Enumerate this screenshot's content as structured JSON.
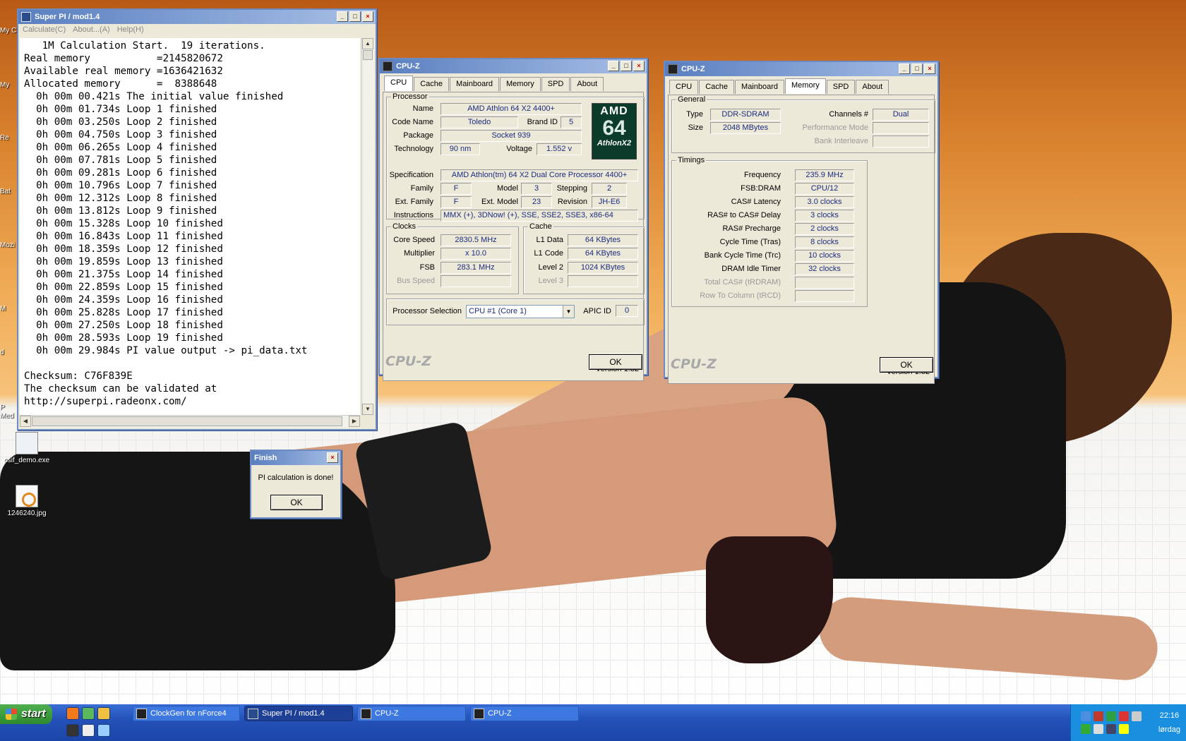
{
  "desktop": {
    "icons": [
      {
        "label": "csif_demo.exe"
      },
      {
        "label": "1246240.jpg"
      }
    ],
    "edge_labels": [
      "My C",
      "My",
      "Re",
      "Bat",
      "Mozi",
      "M",
      "d",
      "P",
      "Med"
    ]
  },
  "superpi": {
    "title": "Super PI / mod1.4",
    "menu": [
      "Calculate(C)",
      "About...(A)",
      "Help(H)"
    ],
    "lines": [
      "   1M Calculation Start.  19 iterations.",
      "Real memory           =2145820672",
      "Available real memory =1636421632",
      "Allocated memory      =  8388648",
      "  0h 00m 00.421s The initial value finished",
      "  0h 00m 01.734s Loop 1 finished",
      "  0h 00m 03.250s Loop 2 finished",
      "  0h 00m 04.750s Loop 3 finished",
      "  0h 00m 06.265s Loop 4 finished",
      "  0h 00m 07.781s Loop 5 finished",
      "  0h 00m 09.281s Loop 6 finished",
      "  0h 00m 10.796s Loop 7 finished",
      "  0h 00m 12.312s Loop 8 finished",
      "  0h 00m 13.812s Loop 9 finished",
      "  0h 00m 15.328s Loop 10 finished",
      "  0h 00m 16.843s Loop 11 finished",
      "  0h 00m 18.359s Loop 12 finished",
      "  0h 00m 19.859s Loop 13 finished",
      "  0h 00m 21.375s Loop 14 finished",
      "  0h 00m 22.859s Loop 15 finished",
      "  0h 00m 24.359s Loop 16 finished",
      "  0h 00m 25.828s Loop 17 finished",
      "  0h 00m 27.250s Loop 18 finished",
      "  0h 00m 28.593s Loop 19 finished",
      "  0h 00m 29.984s PI value output -> pi_data.txt",
      "",
      "Checksum: C76F839E",
      "The checksum can be validated at",
      "http://superpi.radeonx.com/"
    ]
  },
  "finish": {
    "title": "Finish",
    "message": "PI calculation is done!",
    "ok": "OK"
  },
  "cpuz_cpu": {
    "title": "CPU-Z",
    "tabs": [
      "CPU",
      "Cache",
      "Mainboard",
      "Memory",
      "SPD",
      "About"
    ],
    "processor_group": "Processor",
    "name_label": "Name",
    "name": "AMD Athlon 64 X2 4400+",
    "codename_label": "Code Name",
    "codename": "Toledo",
    "brandid_label": "Brand ID",
    "brandid": "5",
    "package_label": "Package",
    "package": "Socket 939",
    "technology_label": "Technology",
    "technology": "90 nm",
    "voltage_label": "Voltage",
    "voltage": "1.552 v",
    "spec_label": "Specification",
    "spec": "AMD Athlon(tm) 64 X2 Dual Core Processor 4400+",
    "family_label": "Family",
    "family": "F",
    "model_label": "Model",
    "model": "3",
    "stepping_label": "Stepping",
    "stepping": "2",
    "extfamily_label": "Ext. Family",
    "extfamily": "F",
    "extmodel_label": "Ext. Model",
    "extmodel": "23",
    "revision_label": "Revision",
    "revision": "JH-E6",
    "instructions_label": "Instructions",
    "instructions": "MMX (+), 3DNow! (+), SSE, SSE2, SSE3, x86-64",
    "logo": {
      "line1": "AMD",
      "line2": "64",
      "line3": "AthlonX2"
    },
    "clocks_group": "Clocks",
    "corespeed_label": "Core Speed",
    "corespeed": "2830.5 MHz",
    "multiplier_label": "Multiplier",
    "multiplier": "x 10.0",
    "fsb_label": "FSB",
    "fsb": "283.1 MHz",
    "busspeed_label": "Bus Speed",
    "cache_group": "Cache",
    "l1data_label": "L1 Data",
    "l1data": "64 KBytes",
    "l1code_label": "L1 Code",
    "l1code": "64 KBytes",
    "level2_label": "Level 2",
    "level2": "1024 KBytes",
    "level3_label": "Level 3",
    "procsel_label": "Processor Selection",
    "procsel": "CPU #1 (Core 1)",
    "apic_label": "APIC ID",
    "apic": "0",
    "version": "Version 1.32",
    "brand": "CPU-Z",
    "ok": "OK"
  },
  "cpuz_mem": {
    "title": "CPU-Z",
    "tabs": [
      "CPU",
      "Cache",
      "Mainboard",
      "Memory",
      "SPD",
      "About"
    ],
    "general_group": "General",
    "type_label": "Type",
    "type": "DDR-SDRAM",
    "size_label": "Size",
    "size": "2048 MBytes",
    "channels_label": "Channels #",
    "channels": "Dual",
    "perfmode_label": "Performance Mode",
    "bankint_label": "Bank Interleave",
    "timings_group": "Timings",
    "frequency_label": "Frequency",
    "frequency": "235.9 MHz",
    "fsbdram_label": "FSB:DRAM",
    "fsbdram": "CPU/12",
    "cas_label": "CAS# Latency",
    "cas": "3.0 clocks",
    "rcd_label": "RAS# to CAS# Delay",
    "rcd": "3 clocks",
    "rp_label": "RAS# Precharge",
    "rp": "2 clocks",
    "tras_label": "Cycle Time (Tras)",
    "tras": "8 clocks",
    "trc_label": "Bank Cycle Time (Trc)",
    "trc": "10 clocks",
    "idle_label": "DRAM Idle Timer",
    "idle": "32 clocks",
    "totalcas_label": "Total CAS# (tRDRAM)",
    "rowcol_label": "Row To Column (tRCD)",
    "version": "Version 1.32",
    "brand": "CPU-Z",
    "ok": "OK"
  },
  "taskbar": {
    "start": "start",
    "tasks": [
      "ClockGen for nForce4",
      "Super PI / mod1.4",
      "CPU-Z",
      "CPU-Z"
    ],
    "clock": "22:16",
    "day": "lørdag",
    "tray_colors": [
      "#4c8fe0",
      "#c0392b",
      "#2ea043",
      "#d33",
      "#ccc",
      "#3a3",
      "#ddd",
      "#446",
      "#ff0"
    ]
  }
}
